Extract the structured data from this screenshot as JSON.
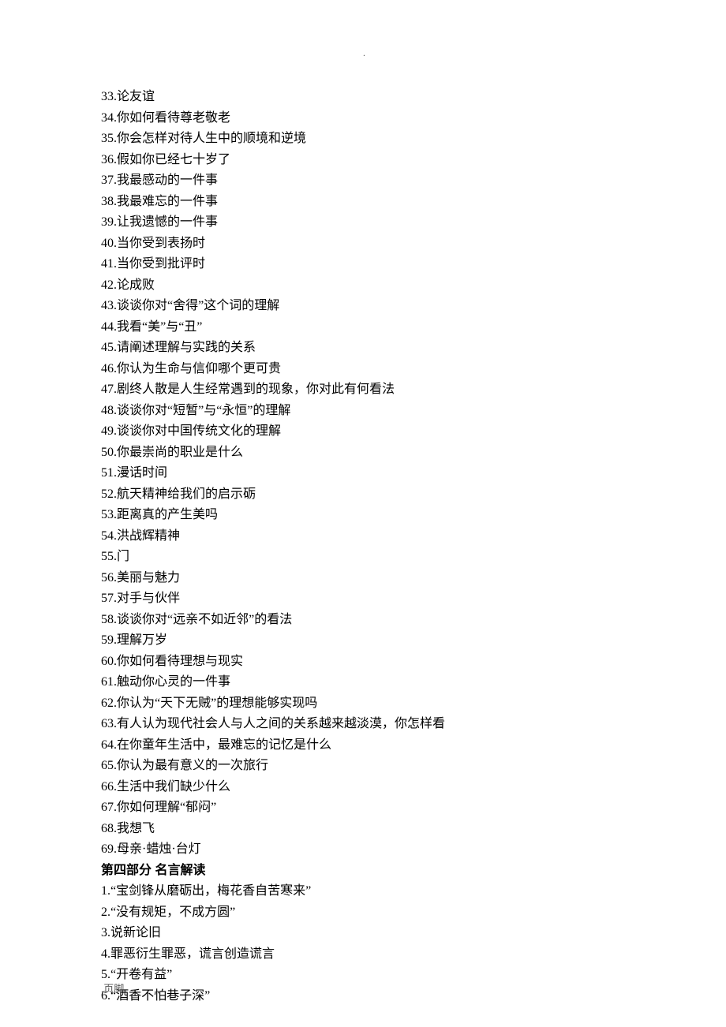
{
  "header": {
    "mark": "."
  },
  "list1": {
    "start": 33,
    "items": [
      "论友谊",
      "你如何看待尊老敬老",
      "你会怎样对待人生中的顺境和逆境",
      "假如你已经七十岁了",
      "我最感动的一件事",
      "我最难忘的一件事",
      "让我遗憾的一件事",
      "当你受到表扬时",
      "当你受到批评时",
      "论成败",
      "谈谈你对\"舍得\"这个词的理解",
      "我看\"美\"与\"丑\"",
      "请阐述理解与实践的关系",
      "你认为生命与信仰哪个更可贵",
      "剧终人散是人生经常遇到的现象，你对此有何看法",
      "谈谈你对\"短暂\"与\"永恒\"的理解",
      "谈谈你对中国传统文化的理解",
      "你最崇尚的职业是什么",
      "漫话时间",
      "航天精神给我们的启示砺",
      "距离真的产生美吗",
      "洪战辉精神",
      "门",
      "美丽与魅力",
      "对手与伙伴",
      "谈谈你对\"远亲不如近邻\"的看法",
      "理解万岁",
      "你如何看待理想与现实",
      "触动你心灵的一件事",
      "你认为\"天下无贼\"的理想能够实现吗",
      "有人认为现代社会人与人之间的关系越来越淡漠，你怎样看",
      "在你童年生活中，最难忘的记忆是什么",
      "你认为最有意义的一次旅行",
      "生活中我们缺少什么",
      "你如何理解\"郁闷\"",
      "我想飞",
      "母亲·蜡烛·台灯"
    ]
  },
  "section_heading": "第四部分 名言解读",
  "list2": {
    "start": 1,
    "items": [
      "\"宝剑锋从磨砺出，梅花香自苦寒来\"",
      "\"没有规矩，不成方圆\"",
      "说新论旧",
      "罪恶衍生罪恶，谎言创造谎言",
      "\"开卷有益\"",
      "\"酒香不怕巷子深\""
    ]
  },
  "footer": {
    "text": ".页脚."
  }
}
